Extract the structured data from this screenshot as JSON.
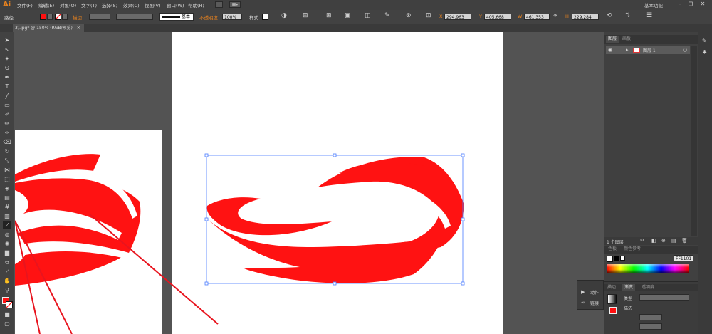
{
  "app": {
    "logo": "Ai"
  },
  "menu": [
    "文件(F)",
    "编辑(E)",
    "对象(O)",
    "文字(T)",
    "选择(S)",
    "效果(C)",
    "视图(V)",
    "窗口(W)",
    "帮助(H)"
  ],
  "workspace": "基本功能",
  "control_bar": {
    "selection_label": "路径",
    "stroke_label": "描边",
    "stroke_style": "基本",
    "opacity_label": "不透明度",
    "opacity_value": "100%",
    "style_label": "样式",
    "x_value": "294.963",
    "y_value": "405.668",
    "w_value": "461.353",
    "h_value": "229.284"
  },
  "document_tab": {
    "title": "3).jpg* @ 150% (RGB/预览)"
  },
  "layers_panel": {
    "tabs": [
      "图层",
      "画板"
    ],
    "layer_name": "图层 1",
    "footer_count": "1 个图层"
  },
  "color_panel": {
    "tabs": [
      "色板",
      "颜色参考"
    ],
    "hex_value": "FF1101",
    "fill_color": "#ff1010"
  },
  "actions_panel": {
    "items": [
      "动作",
      "链接"
    ]
  },
  "gradient_panel": {
    "tabs": [
      "描边",
      "渐变",
      "透明度"
    ],
    "type_label": "类型",
    "stroke_label": "描边"
  },
  "colors": {
    "artwork_red": "#ff1212",
    "selection_blue": "#4a7cff",
    "arrow_red": "#e8141e",
    "accent_orange": "#e8821e"
  }
}
